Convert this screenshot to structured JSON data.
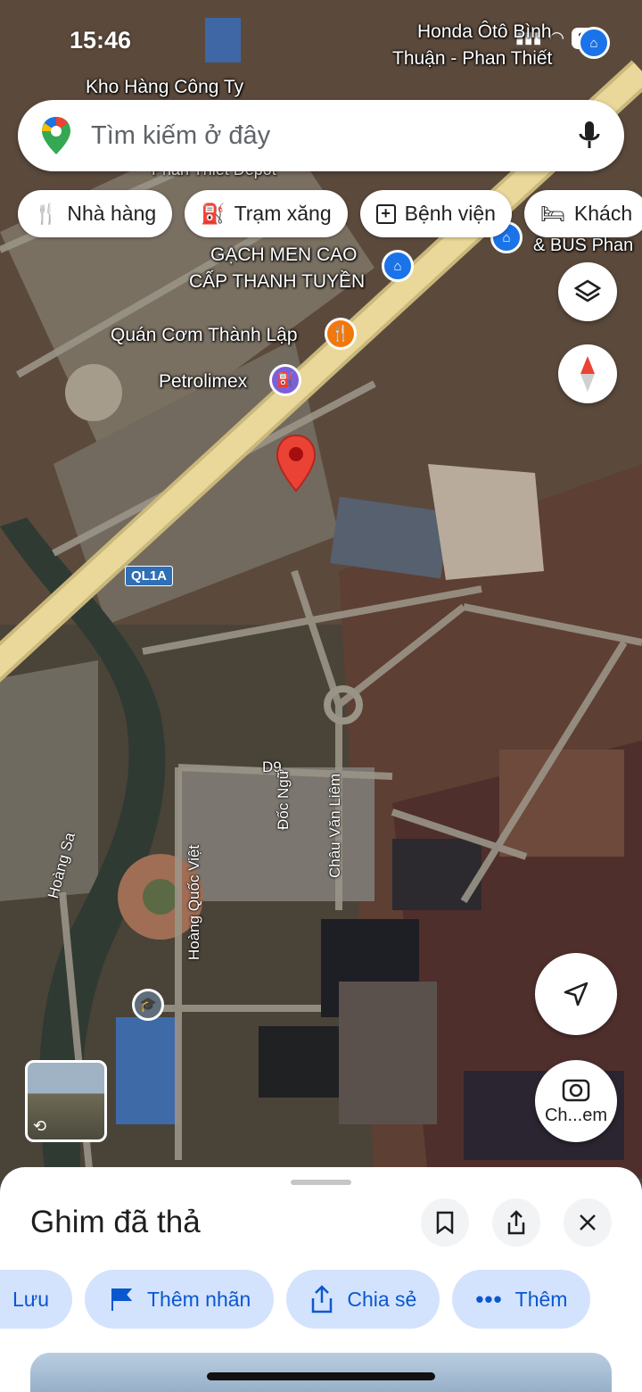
{
  "status_bar": {
    "time": "15:46",
    "battery": "87"
  },
  "search": {
    "placeholder": "Tìm kiếm ở đây"
  },
  "chips": [
    {
      "label": "Nhà hàng",
      "icon": "restaurant-icon"
    },
    {
      "label": "Trạm xăng",
      "icon": "gas-station-icon"
    },
    {
      "label": "Bệnh viện",
      "icon": "hospital-icon"
    },
    {
      "label": "Khách",
      "icon": "hotel-icon"
    }
  ],
  "map": {
    "places": {
      "honda_line1": "Honda Ôtô Bình",
      "honda_line2": "Thuận - Phan Thiết",
      "kho_hang": "Kho Hàng Công Ty",
      "depot": "Phan Thiết Depot",
      "gach_men_line1": "GẠCH MEN CAO",
      "gach_men_line2": "CẤP THANH TUYỀN",
      "quan_com": "Quán Cơm Thành Lập",
      "petrolimex": "Petrolimex",
      "bus": "& BUS Phan"
    },
    "roads": {
      "ql1a": "QL1A",
      "d9": "D9",
      "duc_ngu": "Đốc Ngữ",
      "chau_van_liem": "Châu Văn Liêm",
      "hoang_quoc_viet": "Hoàng Quốc Việt",
      "hoang_sa": "Hoàng Sa"
    },
    "street_view_label": "Ch...em"
  },
  "sheet": {
    "title": "Ghim đã thả",
    "actions": [
      {
        "label": "Lưu"
      },
      {
        "label": "Thêm nhãn"
      },
      {
        "label": "Chia sẻ"
      },
      {
        "label": "Thêm"
      }
    ]
  },
  "colors": {
    "accent": "#0b57d0",
    "pin": "#ea4335",
    "chip_bg": "#d3e3fd",
    "highway": "#e9d89a"
  }
}
